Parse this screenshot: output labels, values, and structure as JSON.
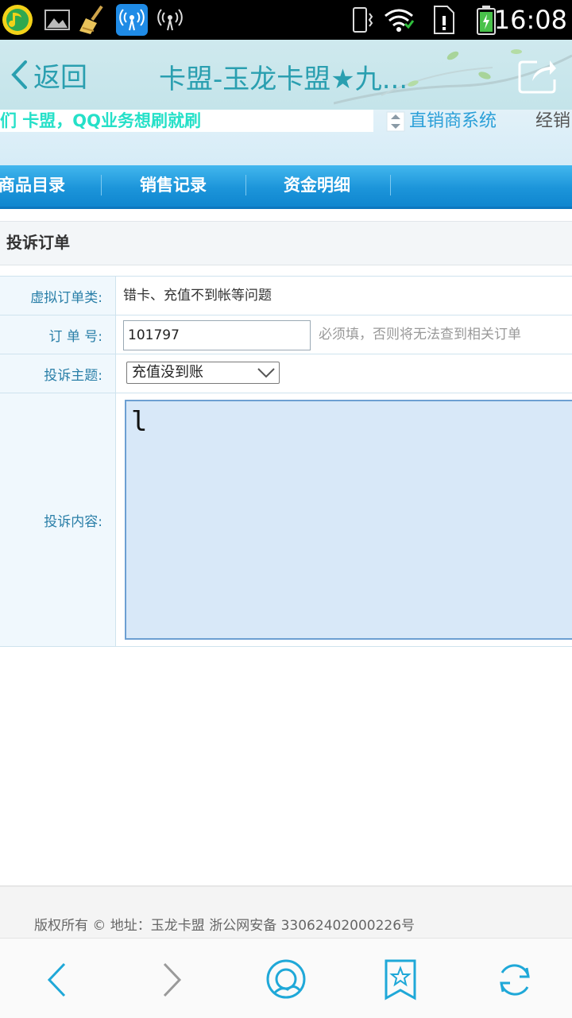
{
  "status_bar": {
    "time": "16:08"
  },
  "app_header": {
    "back_label": "返回",
    "title": "卡盟-玉龙卡盟★九..."
  },
  "banner": {
    "marquee_text": "们 卡盟，QQ业务想刷就刷",
    "system_link": "直销商系统",
    "dealer_link": "经销"
  },
  "nav": {
    "items": [
      {
        "label": "商品目录"
      },
      {
        "label": "销售记录"
      },
      {
        "label": "资金明细"
      }
    ]
  },
  "panel": {
    "title": "投诉订单"
  },
  "form": {
    "category_label": "虚拟订单类:",
    "category_value": "错卡、充值不到帐等问题",
    "order_label": "订 单 号:",
    "order_value": "101797",
    "order_hint": "必须填，否则将无法查到相关订单",
    "subject_label": "投诉主题:",
    "subject_selected": "充值没到账",
    "content_label": "投诉内容:",
    "content_value": "l"
  },
  "footer": {
    "text": "版权所有 © 地址：玉龙卡盟 浙公网安备 33062402000226号"
  },
  "colors": {
    "accent": "#2a9fb0",
    "nav_blue": "#1c95da",
    "marquee": "#25e0c8"
  }
}
